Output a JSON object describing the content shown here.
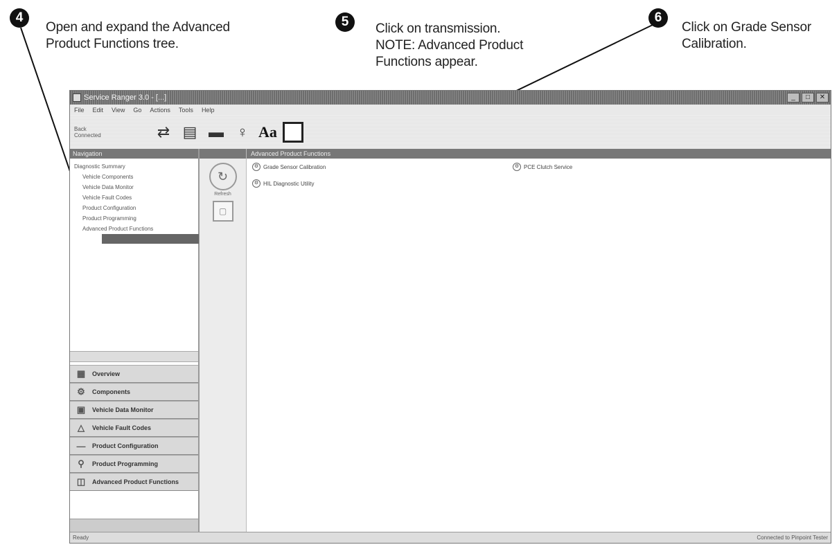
{
  "callouts": [
    {
      "number": "4",
      "text": "Open and expand the Advanced\nProduct Functions tree."
    },
    {
      "number": "5",
      "text": "Click on transmission.\nNOTE: Advanced Product\nFunctions appear."
    },
    {
      "number": "6",
      "text": "Click on Grade Sensor\nCalibration."
    }
  ],
  "window": {
    "title": "Service Ranger 3.0 - [...]",
    "buttons": {
      "minimize": "_",
      "maximize": "□",
      "close": "✕"
    }
  },
  "menu": [
    "File",
    "Edit",
    "View",
    "Go",
    "Actions",
    "Tools",
    "Help"
  ],
  "toolbar": {
    "back_label": "Back",
    "back_sub": "Connected"
  },
  "left_pane": {
    "header": "Navigation",
    "tree": [
      "Diagnostic Summary",
      "Vehicle Components",
      "Vehicle Data Monitor",
      "Vehicle Fault Codes",
      "Product Configuration",
      "Product Programming",
      "Advanced Product Functions"
    ],
    "nav_buttons": [
      "Overview",
      "Components",
      "Vehicle Data Monitor",
      "Vehicle Fault Codes",
      "Product Configuration",
      "Product Programming",
      "Advanced Product Functions"
    ]
  },
  "strip": {
    "refresh_label": "Refresh"
  },
  "content": {
    "header": "Advanced Product Functions",
    "functions": [
      "Grade Sensor Calibration",
      "HIL Diagnostic Utility",
      "PCE Clutch Service"
    ]
  },
  "status": {
    "left": "Ready",
    "right": "Connected to Pinpoint Tester"
  }
}
